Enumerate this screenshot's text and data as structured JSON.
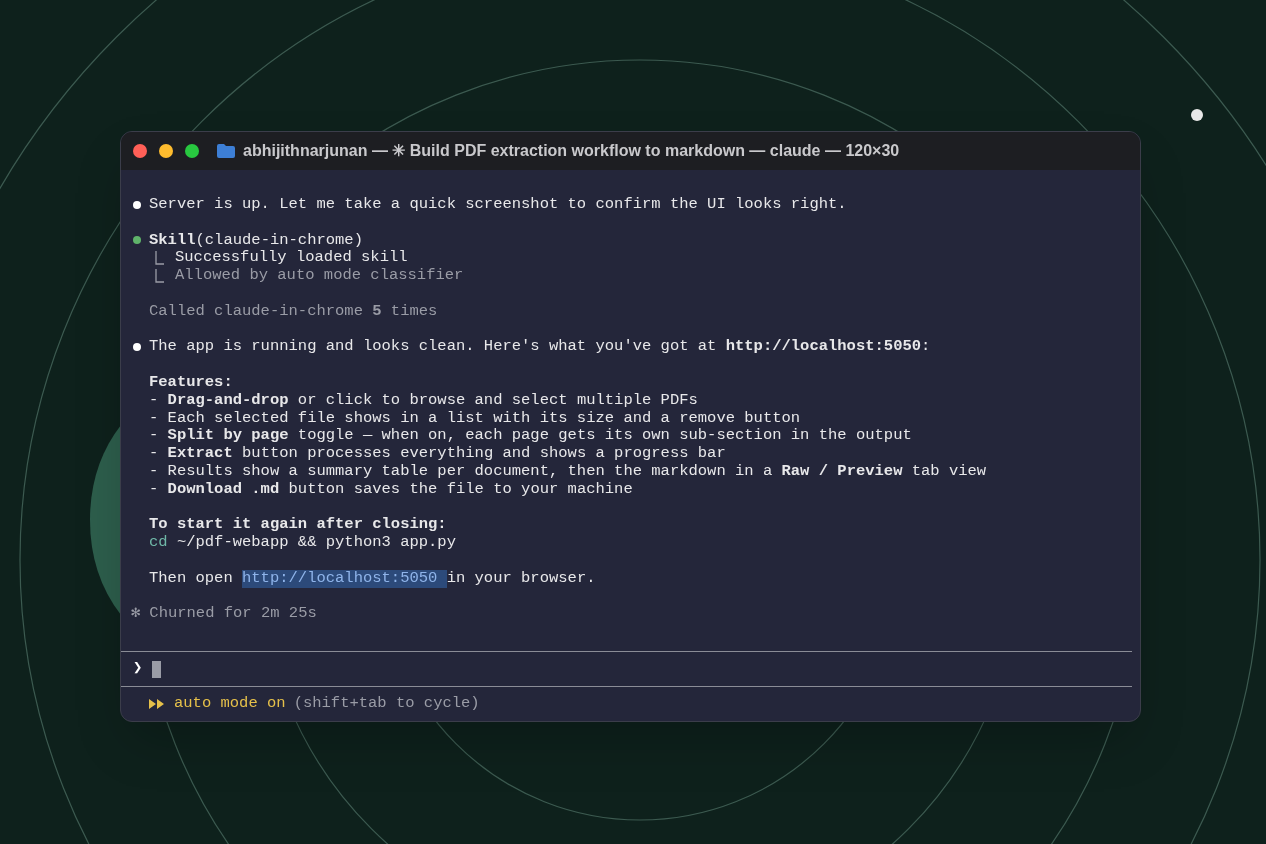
{
  "window": {
    "title": "abhijithnarjunan — ✳ Build PDF extraction workflow to markdown — claude — 120×30"
  },
  "blocks": [
    {
      "lines": [
        {
          "kind": "message",
          "color": "#ffffff",
          "text": "Server is up. Let me take a quick screenshot to confirm the UI looks right."
        }
      ]
    },
    {
      "lines": [
        {
          "kind": "message",
          "color": "#5fb36a",
          "text": "**Skill**(claude-in-chrome)"
        },
        {
          "kind": "tree",
          "dim": false,
          "text": "Successfully loaded skill"
        },
        {
          "kind": "tree",
          "dim": true,
          "text": "Allowed by auto mode classifier"
        }
      ]
    },
    {
      "lines": [
        {
          "kind": "plain",
          "dim": true,
          "text": "Called claude-in-chrome **5** times"
        }
      ]
    },
    {
      "lines": [
        {
          "kind": "message",
          "color": "#ffffff",
          "text": "The app is running and looks clean. Here's what you've got at **http://localhost:5050**:"
        }
      ]
    },
    {
      "lines": [
        {
          "kind": "plain",
          "dim": false,
          "text": "**Features:**"
        },
        {
          "kind": "plain",
          "dim": false,
          "text": "- **Drag-and-drop** or click to browse and select multiple PDFs"
        },
        {
          "kind": "plain",
          "dim": false,
          "text": "- Each selected file shows in a list with its size and a remove button"
        },
        {
          "kind": "plain",
          "dim": false,
          "text": "- **Split by page** toggle — when on, each page gets its own sub-section in the output"
        },
        {
          "kind": "plain",
          "dim": false,
          "text": "- **Extract** button processes everything and shows a progress bar"
        },
        {
          "kind": "plain",
          "dim": false,
          "text": "- Results show a summary table per document, then the markdown in a **Raw / Preview** tab view"
        },
        {
          "kind": "plain",
          "dim": false,
          "text": "- **Download .md** button saves the file to your machine"
        }
      ]
    },
    {
      "lines": [
        {
          "kind": "plain",
          "dim": false,
          "text": "**To start it again after closing:**"
        },
        {
          "kind": "command",
          "program": "cd",
          "text": "~/pdf-webapp && python3 app.py"
        }
      ]
    },
    {
      "lines": [
        {
          "kind": "link",
          "before": "Then open",
          "link": "http://localhost:5050",
          "selected": true,
          "after": "in your browser."
        }
      ]
    },
    {
      "lines": [
        {
          "kind": "status",
          "glyph": "✻",
          "text": "Churned for 2m 25s"
        }
      ]
    }
  ],
  "prompt": {
    "symbol": "❯"
  },
  "footer": {
    "mode": "auto mode on",
    "hint": "(shift+tab to cycle)"
  }
}
